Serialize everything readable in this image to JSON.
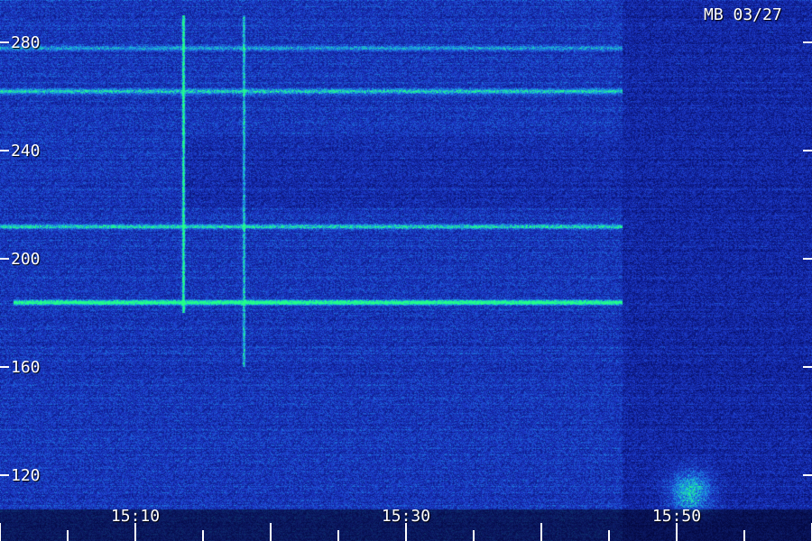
{
  "station_label": "MB 03/27",
  "chart_data": {
    "type": "heatmap",
    "title": "",
    "xlabel": "",
    "ylabel": "",
    "x_tick_labels": [
      "15:10",
      "15:30",
      "15:50"
    ],
    "y_tick_labels": [
      "280",
      "240",
      "200",
      "160",
      "120"
    ],
    "x_ticks": [
      "15:10",
      "15:30",
      "15:50"
    ],
    "y_ticks": [
      280,
      240,
      200,
      160,
      120
    ],
    "yrange_mhz": [
      110,
      290
    ],
    "xrange_time": [
      "15:00",
      "15:60"
    ],
    "colormap": [
      "#000022",
      "#0a1680",
      "#1e3ccc",
      "#1aa0e6",
      "#22ff88"
    ],
    "features": [
      {
        "kind": "horizontal_band",
        "freq": 184,
        "t_start": "15:01",
        "t_end": "15:46",
        "intensity": "high"
      },
      {
        "kind": "horizontal_band",
        "freq": 212,
        "t_start": "15:00",
        "t_end": "15:46",
        "intensity": "medium"
      },
      {
        "kind": "horizontal_band",
        "freq": 262,
        "t_start": "15:00",
        "t_end": "15:46",
        "intensity": "medium"
      },
      {
        "kind": "horizontal_band",
        "freq": 278,
        "t_start": "15:00",
        "t_end": "15:46",
        "intensity": "low"
      },
      {
        "kind": "vertical_line",
        "time": "15:13.5",
        "freq_start": 180,
        "freq_end": 290,
        "intensity": "high"
      },
      {
        "kind": "vertical_line",
        "time": "15:18",
        "freq_start": 160,
        "freq_end": 290,
        "intensity": "medium"
      },
      {
        "kind": "blob",
        "time": "15:51",
        "freq": 114,
        "intensity": "medium"
      }
    ]
  }
}
